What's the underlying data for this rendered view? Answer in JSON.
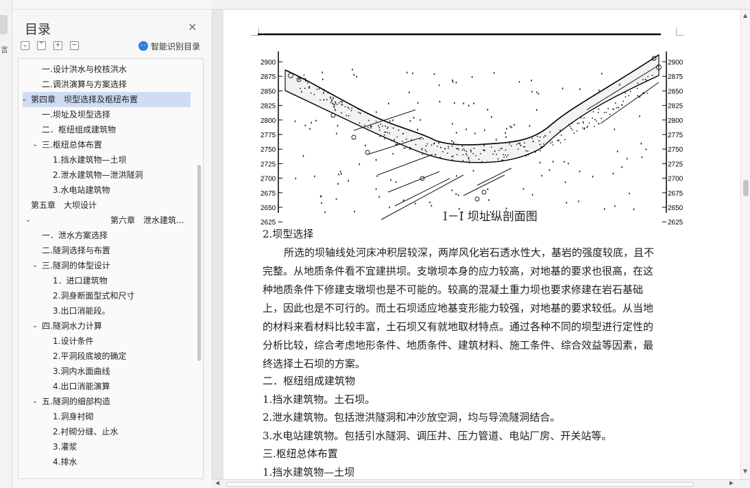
{
  "sidebar_strip": {
    "tab_text": "言"
  },
  "toc": {
    "title": "目录",
    "smart_label": "智能识别目录",
    "items": [
      {
        "label": "一.设计洪水与校核洪水",
        "level": 2,
        "arrow": ""
      },
      {
        "label": "二.调洪演算与方案选择",
        "level": 2,
        "arrow": ""
      },
      {
        "label": "第四章　坝型选择及枢纽布置",
        "level": 1,
        "arrow": "v",
        "selected": true
      },
      {
        "label": "一.坝址及坝型选择",
        "level": 2,
        "arrow": ""
      },
      {
        "label": "二．枢纽组成建筑物",
        "level": 2,
        "arrow": ""
      },
      {
        "label": "三.枢纽总体布置",
        "level": 2,
        "arrow": "v"
      },
      {
        "label": "1.挡水建筑物—土坝",
        "level": 3,
        "arrow": ""
      },
      {
        "label": "2.泄水建筑物—泄洪隧洞",
        "level": 3,
        "arrow": ""
      },
      {
        "label": "3.水电站建筑物",
        "level": 3,
        "arrow": ""
      },
      {
        "label": "第五章　大坝设计",
        "level": 1,
        "arrow": ""
      },
      {
        "label": "第六章　泄水建筑...",
        "level": 0,
        "arrow": "v"
      },
      {
        "label": "一．泄水方案选择",
        "level": 2,
        "arrow": ""
      },
      {
        "label": "二.隧洞选择与布置",
        "level": 2,
        "arrow": ""
      },
      {
        "label": "三.隧洞的体型设计",
        "level": 2,
        "arrow": "v"
      },
      {
        "label": "1．进口建筑物",
        "level": 3,
        "arrow": ""
      },
      {
        "label": "2.洞身断面型式和尺寸",
        "level": 3,
        "arrow": ""
      },
      {
        "label": "3.出口消能段。",
        "level": 3,
        "arrow": ""
      },
      {
        "label": "四.隧洞水力计算",
        "level": 2,
        "arrow": "v"
      },
      {
        "label": "1.设计条件",
        "level": 3,
        "arrow": ""
      },
      {
        "label": "2.平洞段底坡的确定",
        "level": 3,
        "arrow": ""
      },
      {
        "label": "3.洞内水面曲线",
        "level": 3,
        "arrow": ""
      },
      {
        "label": "4.出口消能演算",
        "level": 3,
        "arrow": ""
      },
      {
        "label": "五.隧洞的细部构造",
        "level": 2,
        "arrow": "v"
      },
      {
        "label": "1.洞身衬砌",
        "level": 3,
        "arrow": ""
      },
      {
        "label": "2.衬砌分缝、止水",
        "level": 3,
        "arrow": ""
      },
      {
        "label": "3.灌浆",
        "level": 3,
        "arrow": ""
      },
      {
        "label": "4.排水",
        "level": 3,
        "arrow": ""
      }
    ]
  },
  "figure": {
    "caption": "Ⅰ－Ⅰ 坝址纵剖面图",
    "elevations": [
      "2900",
      "2875",
      "2850",
      "2825",
      "2800",
      "2775",
      "2750",
      "2725",
      "2700",
      "2675",
      "2650",
      "2625"
    ]
  },
  "document": {
    "section_heading": "2.坝型选择",
    "paragraph_lines": [
      "所选的坝轴线处河床冲积层较深，两岸风化岩石透水性大，基岩的强度较底，且不",
      "完整。从地质条件看不宜建拱坝。支墩坝本身的应力较高，对地基的要求也很高，在这",
      "种地质条件下修建支墩坝也是不可能的。较高的混凝土重力坝也要求修建在岩石基础",
      "上，因此也是不可行的。而土石坝适应地基变形能力较强，对地基的要求较低。从当地",
      "的材料来看材料比较丰富，土石坝又有就地取材特点。通过各种不同的坝型进行定性的",
      "分析比较，综合考虑地形条件、地质条件、建筑材料、施工条件、综合效益等因素，最",
      "终选择土石坝的方案。"
    ],
    "lines_after": [
      "二．枢纽组成建筑物",
      "1.挡水建筑物。土石坝。",
      "2.泄水建筑物。包括泄洪隧洞和冲沙放空洞，均与导流隧洞结合。",
      "3.水电站建筑物。包括引水隧洞、调压井、压力管道、电站厂房、开关站等。",
      "三.枢纽总体布置",
      "1.挡水建筑物—土坝"
    ]
  }
}
